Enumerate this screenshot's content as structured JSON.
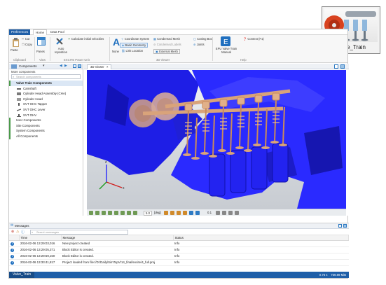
{
  "thumbnail": {
    "label": "Valve_Train"
  },
  "menu": {
    "preferences": "Preferences",
    "home": "Home",
    "data_pool": "Data Pool"
  },
  "ribbon": {
    "cut": "Cut",
    "copy": "Copy",
    "paste": "Paste",
    "panes": "Panes",
    "clipboard_group": "Clipboard",
    "view_group": "View",
    "calculate": "Calculate initial velocities",
    "auto_reposition": "Auto reposition",
    "excite_group": "EXCITE Power Unit",
    "coordinate_system": "Coordinate System",
    "basic_geometry": "Basic Geometry",
    "link_location": "Link Location",
    "none": "None",
    "condensed_mesh": "Condensed Mesh",
    "condensed_labels": "Condensed Labels",
    "external_mesh": "External Mesh",
    "cutting_box": "Cutting Box",
    "joints": "Joints",
    "viewer_group": "3D Viewer",
    "epu_manual": "EPU Valve Train Manual",
    "context": "Context (F1)",
    "help_group": "Help"
  },
  "components": {
    "title": "Components",
    "more": "More components",
    "search_placeholder": "Search components",
    "section": "Valve Train Components",
    "items": [
      "Camshaft",
      "Cylinder Head Assembly (CHA)",
      "Cylinder Head",
      "SVT OHC Tappet",
      "SVT OHC Lever",
      "SVT OHV"
    ],
    "categories": [
      "User Components",
      "Site Components",
      "System Components",
      "All Components"
    ]
  },
  "viewer": {
    "tab": "3D Viewer",
    "angle_value": "5.0",
    "angle_unit": "[deg]",
    "step_value": "0.1"
  },
  "messages": {
    "title": "Messages",
    "search_placeholder": "Search messages",
    "columns": [
      "Time",
      "Message",
      "Status"
    ],
    "rows": [
      {
        "time": "2016-02-06 13:29:03,016",
        "message": "New project created",
        "status": "Info"
      },
      {
        "time": "2016-02-06 13:29:05,371",
        "message": "Block Editor is created.",
        "status": "Info"
      },
      {
        "time": "2016-02-06 13:29:59,150",
        "message": "Block Editor is created.",
        "status": "Info"
      },
      {
        "time": "2016-02-06 13:33:41,817",
        "message": "Project loaded from file://D:/Daily/SimTopV/14_final/excite/4_full.proj",
        "status": "Info"
      }
    ]
  },
  "status": {
    "tab": "Valve_Train",
    "time": "0.76 s",
    "memory": "759.89 MiB"
  },
  "colors": {
    "accent": "#1f5fa8",
    "engine_blue": "#1c1cff",
    "valve": "#d9a37a"
  }
}
